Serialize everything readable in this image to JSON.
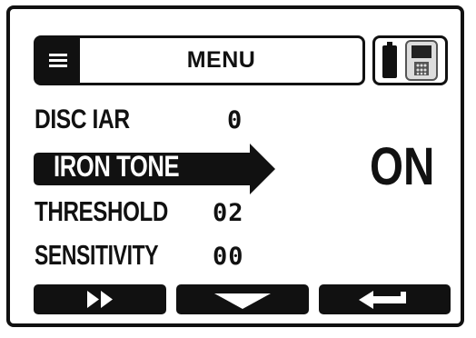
{
  "header": {
    "menu_icon": "hamburger-menu-icon",
    "title": "MENU",
    "device_icon": "battery-and-detector-icon"
  },
  "menu_items": [
    {
      "label": "DISC IAR",
      "value": "0"
    },
    {
      "label": "IRON TONE",
      "selected": true
    },
    {
      "label": "THRESHOLD",
      "value": "02"
    },
    {
      "label": "SENSITIVITY",
      "value": "00"
    }
  ],
  "selected_value": "ON",
  "softkeys": [
    {
      "icon": "fast-forward-icon"
    },
    {
      "icon": "down-arrow-icon"
    },
    {
      "icon": "back-return-icon"
    }
  ],
  "colors": {
    "foreground": "#111111",
    "background": "#ffffff"
  }
}
